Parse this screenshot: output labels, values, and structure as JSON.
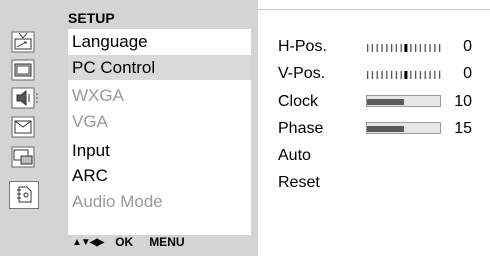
{
  "menu": {
    "title": "SETUP",
    "items": [
      {
        "label": "Language",
        "state": "normal"
      },
      {
        "label": "PC Control",
        "state": "selected"
      },
      {
        "label": "WXGA",
        "state": "disabled"
      },
      {
        "label": "VGA",
        "state": "disabled"
      },
      {
        "label": "Input",
        "state": "normal"
      },
      {
        "label": "ARC",
        "state": "normal"
      },
      {
        "label": "Audio Mode",
        "state": "disabled"
      }
    ],
    "icons": [
      "tv-antenna-icon",
      "picture-icon",
      "sound-icon",
      "timer-icon",
      "pip-icon",
      "setup-icon"
    ]
  },
  "nav": {
    "arrows": "▲▼◀▶",
    "ok_label": "OK",
    "menu_label": "MENU"
  },
  "pc_control": {
    "h_pos": {
      "label": "H-Pos.",
      "value": "0",
      "position": 0.5
    },
    "v_pos": {
      "label": "V-Pos.",
      "value": "0",
      "position": 0.5
    },
    "clock": {
      "label": "Clock",
      "value": "10",
      "level": 0.5
    },
    "phase": {
      "label": "Phase",
      "value": "15",
      "level": 0.5
    },
    "auto": {
      "label": "Auto"
    },
    "reset": {
      "label": "Reset"
    }
  },
  "colors": {
    "panel_bg": "#d4d4d4",
    "selected_bg": "#d9d9d9",
    "disabled_text": "#9a9a9a",
    "bar_fill": "#5a5a5a"
  }
}
